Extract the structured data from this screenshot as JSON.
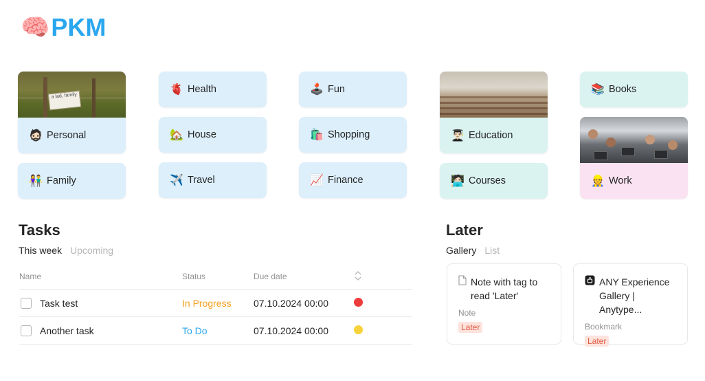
{
  "header": {
    "icon": "brain-emoji",
    "title": "PKM",
    "emoji": "🧠",
    "accent": "#2aa7ee"
  },
  "categories": [
    {
      "label": "Personal",
      "emoji": "🧔🏻",
      "color": "#dceffb",
      "cover": "fence-sign-photo",
      "cover_text": "a lad, family"
    },
    {
      "label": "Family",
      "emoji": "👫",
      "color": "#dceffb"
    },
    {
      "label": "Health",
      "emoji": "🫀",
      "color": "#dceffb"
    },
    {
      "label": "House",
      "emoji": "🏡",
      "color": "#dceffb"
    },
    {
      "label": "Travel",
      "emoji": "✈️",
      "color": "#dceffb"
    },
    {
      "label": "Fun",
      "emoji": "🕹️",
      "color": "#dceffb"
    },
    {
      "label": "Shopping",
      "emoji": "🛍️",
      "color": "#dceffb"
    },
    {
      "label": "Finance",
      "emoji": "📈",
      "color": "#dceffb"
    },
    {
      "label": "Education",
      "emoji": "👨🏻‍🎓",
      "color": "#daf3f1",
      "cover": "lecture-hall-photo"
    },
    {
      "label": "Courses",
      "emoji": "🧑🏻‍💻",
      "color": "#daf3f1"
    },
    {
      "label": "Books",
      "emoji": "📚",
      "color": "#daf3f1"
    },
    {
      "label": "Work",
      "emoji": "👷",
      "color": "#fbe2f2",
      "cover": "office-meeting-photo"
    }
  ],
  "tasks": {
    "title": "Tasks",
    "tabs": [
      "This week",
      "Upcoming"
    ],
    "columns": [
      "Name",
      "Status",
      "Due date"
    ],
    "rows": [
      {
        "name": "Task test",
        "status": "In Progress",
        "status_color": "#f3a11f",
        "due": "07.10.2024 00:00",
        "flag_color": "#ee3b3b"
      },
      {
        "name": "Another task",
        "status": "To Do",
        "status_color": "#2aa7ee",
        "due": "07.10.2024 00:00",
        "flag_color": "#f8d23a"
      }
    ]
  },
  "later": {
    "title": "Later",
    "tabs": [
      "Gallery",
      "List"
    ],
    "cards": [
      {
        "icon": "page-icon",
        "title": "Note with tag to read 'Later'",
        "type": "Note",
        "tag": "Later"
      },
      {
        "icon": "anytype-icon",
        "title": "ANY Experience Gallery | Anytype...",
        "type": "Bookmark",
        "tag": "Later"
      }
    ]
  }
}
